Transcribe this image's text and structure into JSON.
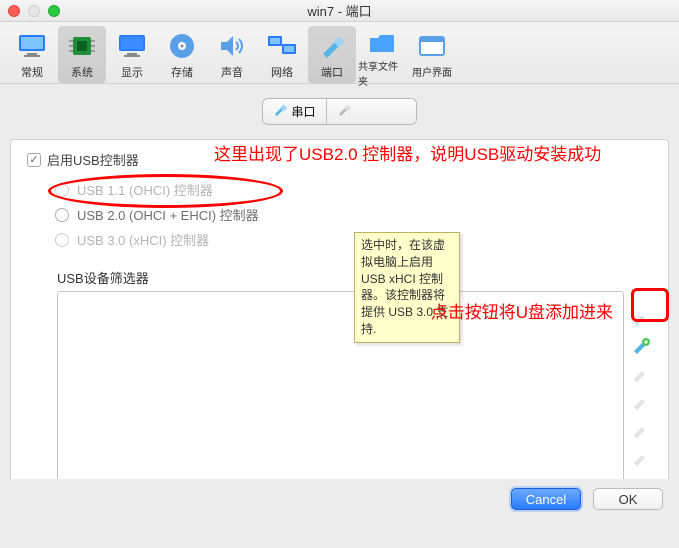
{
  "window": {
    "title": "win7 - 端口"
  },
  "toolbar": {
    "items": [
      {
        "id": "general",
        "label": "常规",
        "icon": "monitor-icon"
      },
      {
        "id": "system",
        "label": "系统",
        "icon": "chip-icon",
        "selected": true
      },
      {
        "id": "display",
        "label": "显示",
        "icon": "display-icon"
      },
      {
        "id": "storage",
        "label": "存储",
        "icon": "disk-icon"
      },
      {
        "id": "audio",
        "label": "声音",
        "icon": "speaker-icon"
      },
      {
        "id": "network",
        "label": "网络",
        "icon": "network-icon"
      },
      {
        "id": "ports",
        "label": "端口",
        "icon": "usb-plug-icon",
        "selected": true
      },
      {
        "id": "shared",
        "label": "共享文件夹",
        "icon": "folder-icon"
      },
      {
        "id": "ui",
        "label": "用户界面",
        "icon": "window-icon"
      }
    ]
  },
  "subtabs": {
    "serial_label": "串口",
    "serial_icon": "usb-plug-icon",
    "usb_icon": "usb-plug-icon"
  },
  "usb": {
    "enable_label": "启用USB控制器",
    "enabled": true,
    "controllers": [
      {
        "id": "usb11",
        "label": "USB 1.1 (OHCI) 控制器",
        "enabled": false
      },
      {
        "id": "usb20",
        "label": "USB 2.0 (OHCI + EHCI) 控制器",
        "enabled": true
      },
      {
        "id": "usb30",
        "label": "USB 3.0 (xHCI) 控制器",
        "enabled": false
      }
    ],
    "filter_label": "USB设备筛选器",
    "tooltip_text": "选中时，在该虚拟电脑上启用 USB xHCI 控制器。该控制器将提供 USB 3.0 支持."
  },
  "annotations": {
    "line1": "这里出现了USB2.0 控制器，说明USB驱动安装成功",
    "line2": "点击按钮将U盘添加进来"
  },
  "side_icons": [
    {
      "name": "filter-settings-icon",
      "active": false
    },
    {
      "name": "usb-add-icon",
      "active": true
    },
    {
      "name": "usb-remove-icon",
      "active": false
    },
    {
      "name": "usb-remove-all-icon",
      "active": false
    },
    {
      "name": "usb-unknown-icon",
      "active": false
    },
    {
      "name": "usb-eject-icon",
      "active": false
    }
  ],
  "footer": {
    "cancel": "Cancel",
    "ok": "OK"
  },
  "colors": {
    "annotation_red": "#ff0000",
    "tooltip_bg": "#ffffcc",
    "primary_blue": "#2a7cff"
  }
}
